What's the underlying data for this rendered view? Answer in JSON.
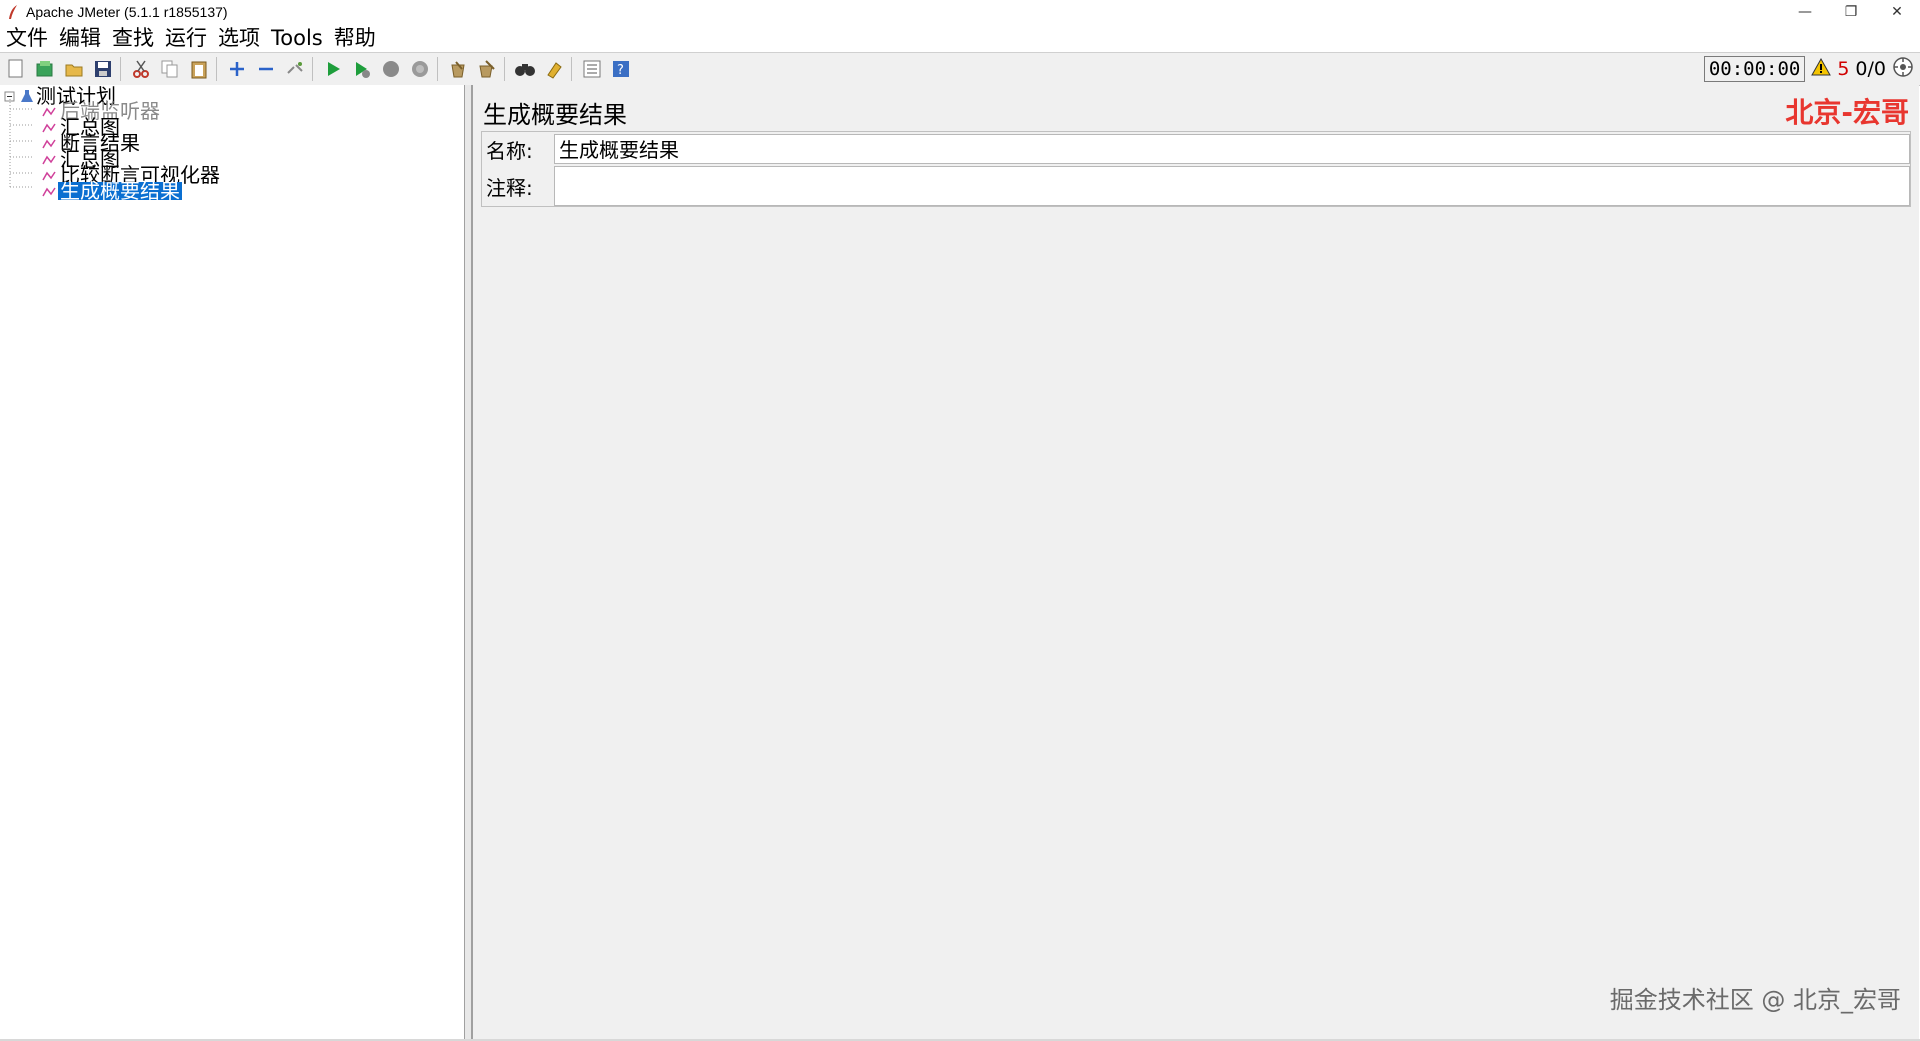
{
  "window": {
    "title": "Apache JMeter (5.1.1 r1855137)",
    "controls": {
      "minimize": "—",
      "restore": "❐",
      "close": "✕"
    }
  },
  "menu": {
    "items": [
      "文件",
      "编辑",
      "查找",
      "运行",
      "选项",
      "Tools",
      "帮助"
    ]
  },
  "toolbar": {
    "icons": [
      "new-icon",
      "templates-icon",
      "open-icon",
      "save-icon",
      "cut-icon",
      "copy-icon",
      "paste-icon",
      "expand-icon",
      "collapse-icon",
      "toggle-icon",
      "start-icon",
      "start-no-pause-icon",
      "stop-icon",
      "shutdown-icon",
      "clear-icon",
      "clear-all-icon",
      "search-icon",
      "reset-search-icon",
      "function-helper-icon",
      "help-icon"
    ],
    "timer": "00:00:00",
    "warning_count": "5",
    "threads": "0/0"
  },
  "tree": {
    "root": "测试计划",
    "children": [
      {
        "label": "后端监听器",
        "disabled": true
      },
      {
        "label": "汇总图",
        "disabled": false
      },
      {
        "label": "断言结果",
        "disabled": false
      },
      {
        "label": "汇总图",
        "disabled": false
      },
      {
        "label": "比较断言可视化器",
        "disabled": false
      },
      {
        "label": "生成概要结果",
        "disabled": false,
        "selected": true
      }
    ]
  },
  "panel": {
    "title": "生成概要结果",
    "watermark": "北京-宏哥",
    "name_label": "名称:",
    "name_value": "生成概要结果",
    "comment_label": "注释:",
    "comment_value": ""
  },
  "footer": {
    "watermark": "掘金技术社区 @ 北京_宏哥"
  },
  "colors": {
    "accent_selected": "#0a6fd1",
    "watermark_red": "#e8362f",
    "warn_red": "#d00000"
  }
}
